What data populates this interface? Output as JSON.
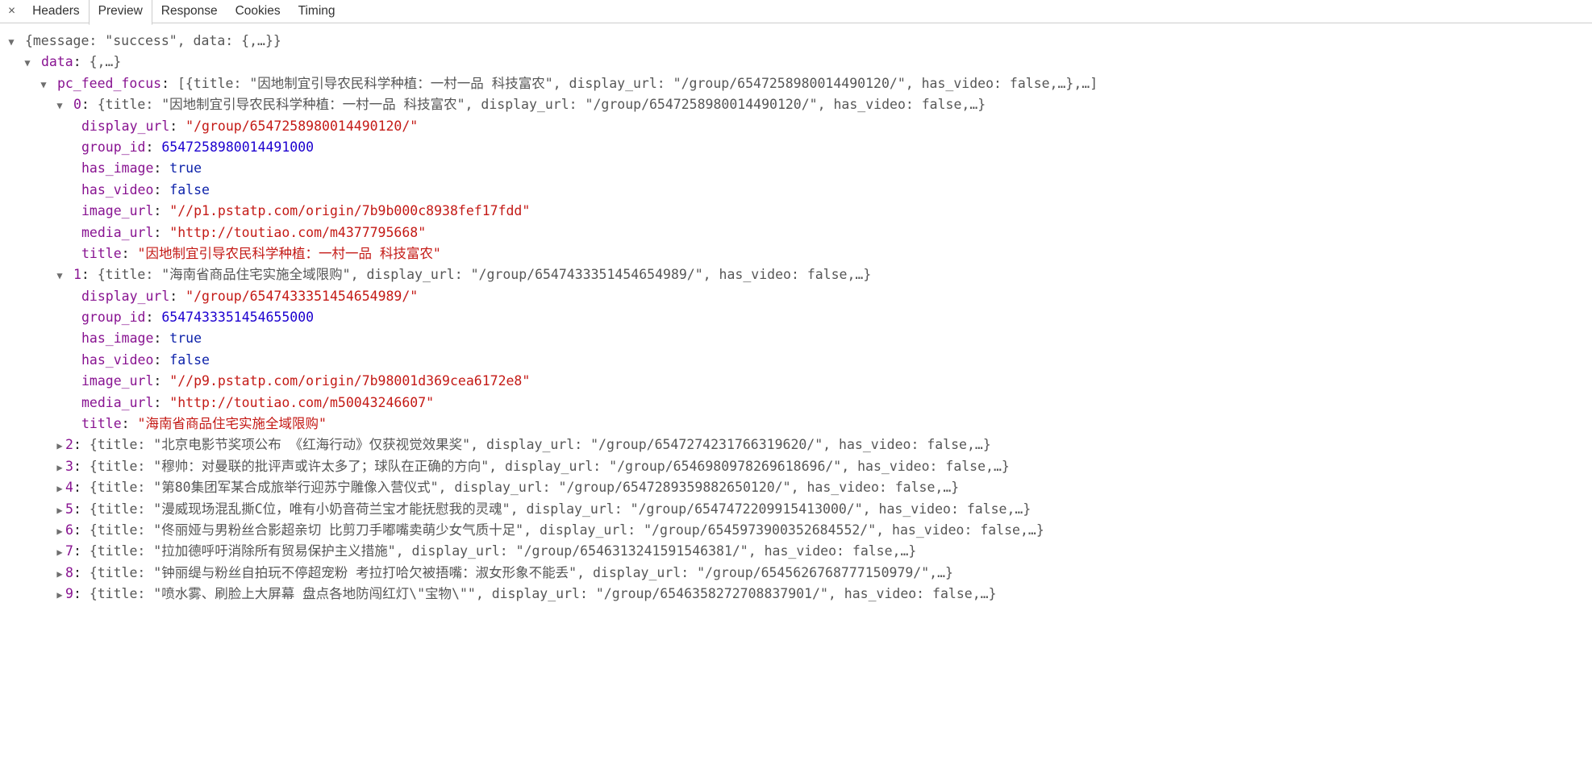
{
  "tabs": {
    "close": "×",
    "headers": "Headers",
    "preview": "Preview",
    "response": "Response",
    "cookies": "Cookies",
    "timing": "Timing"
  },
  "root": {
    "message_key": "message",
    "message_val": "\"success\"",
    "data_key": "data",
    "data_preview": "{,…}",
    "pc_feed_focus_key": "pc_feed_focus",
    "pc_feed_focus_preview_open": "[{title: \"因地制宜引导农民科学种植：一村一品 科技富农\", display_url: \"/group/6547258980014490120/\", has_video: false,…},…]",
    "root_line": "{message: \"success\", data: {,…}}",
    "data_line": "{,…}"
  },
  "item0": {
    "index": "0",
    "summary": "{title: \"因地制宜引导农民科学种植：一村一品 科技富农\", display_url: \"/group/6547258980014490120/\", has_video: false,…}",
    "display_url_key": "display_url",
    "display_url_val": "\"/group/6547258980014490120/\"",
    "group_id_key": "group_id",
    "group_id_val": "6547258980014491000",
    "has_image_key": "has_image",
    "has_image_val": "true",
    "has_video_key": "has_video",
    "has_video_val": "false",
    "image_url_key": "image_url",
    "image_url_val": "\"//p1.pstatp.com/origin/7b9b000c8938fef17fdd\"",
    "media_url_key": "media_url",
    "media_url_val": "\"http://toutiao.com/m4377795668\"",
    "title_key": "title",
    "title_val": "\"因地制宜引导农民科学种植：一村一品 科技富农\""
  },
  "item1": {
    "index": "1",
    "summary": "{title: \"海南省商品住宅实施全域限购\", display_url: \"/group/6547433351454654989/\", has_video: false,…}",
    "display_url_key": "display_url",
    "display_url_val": "\"/group/6547433351454654989/\"",
    "group_id_key": "group_id",
    "group_id_val": "6547433351454655000",
    "has_image_key": "has_image",
    "has_image_val": "true",
    "has_video_key": "has_video",
    "has_video_val": "false",
    "image_url_key": "image_url",
    "image_url_val": "\"//p9.pstatp.com/origin/7b98001d369cea6172e8\"",
    "media_url_key": "media_url",
    "media_url_val": "\"http://toutiao.com/m50043246607\"",
    "title_key": "title",
    "title_val": "\"海南省商品住宅实施全域限购\""
  },
  "collapsed": [
    {
      "index": "2",
      "summary": "{title: \"北京电影节奖项公布 《红海行动》仅获视觉效果奖\", display_url: \"/group/6547274231766319620/\", has_video: false,…}"
    },
    {
      "index": "3",
      "summary": "{title: \"穆帅：对曼联的批评声或许太多了；球队在正确的方向\", display_url: \"/group/6546980978269618696/\", has_video: false,…}"
    },
    {
      "index": "4",
      "summary": "{title: \"第80集团军某合成旅举行迎苏宁雕像入营仪式\", display_url: \"/group/6547289359882650120/\", has_video: false,…}"
    },
    {
      "index": "5",
      "summary": "{title: \"漫威现场混乱撕C位，唯有小奶音荷兰宝才能抚慰我的灵魂\", display_url: \"/group/6547472209915413000/\", has_video: false,…}"
    },
    {
      "index": "6",
      "summary": "{title: \"佟丽娅与男粉丝合影超亲切 比剪刀手嘟嘴卖萌少女气质十足\", display_url: \"/group/6545973900352684552/\", has_video: false,…}"
    },
    {
      "index": "7",
      "summary": "{title: \"拉加德呼吁消除所有贸易保护主义措施\", display_url: \"/group/6546313241591546381/\", has_video: false,…}"
    },
    {
      "index": "8",
      "summary": "{title: \"钟丽缇与粉丝自拍玩不停超宠粉 考拉打哈欠被捂嘴：淑女形象不能丢\", display_url: \"/group/6545626768777150979/\",…}"
    },
    {
      "index": "9",
      "summary": "{title: \"喷水雾、刷脸上大屏幕 盘点各地防闯红灯\\\"宝物\\\"\", display_url: \"/group/6546358272708837901/\", has_video: false,…}"
    }
  ]
}
